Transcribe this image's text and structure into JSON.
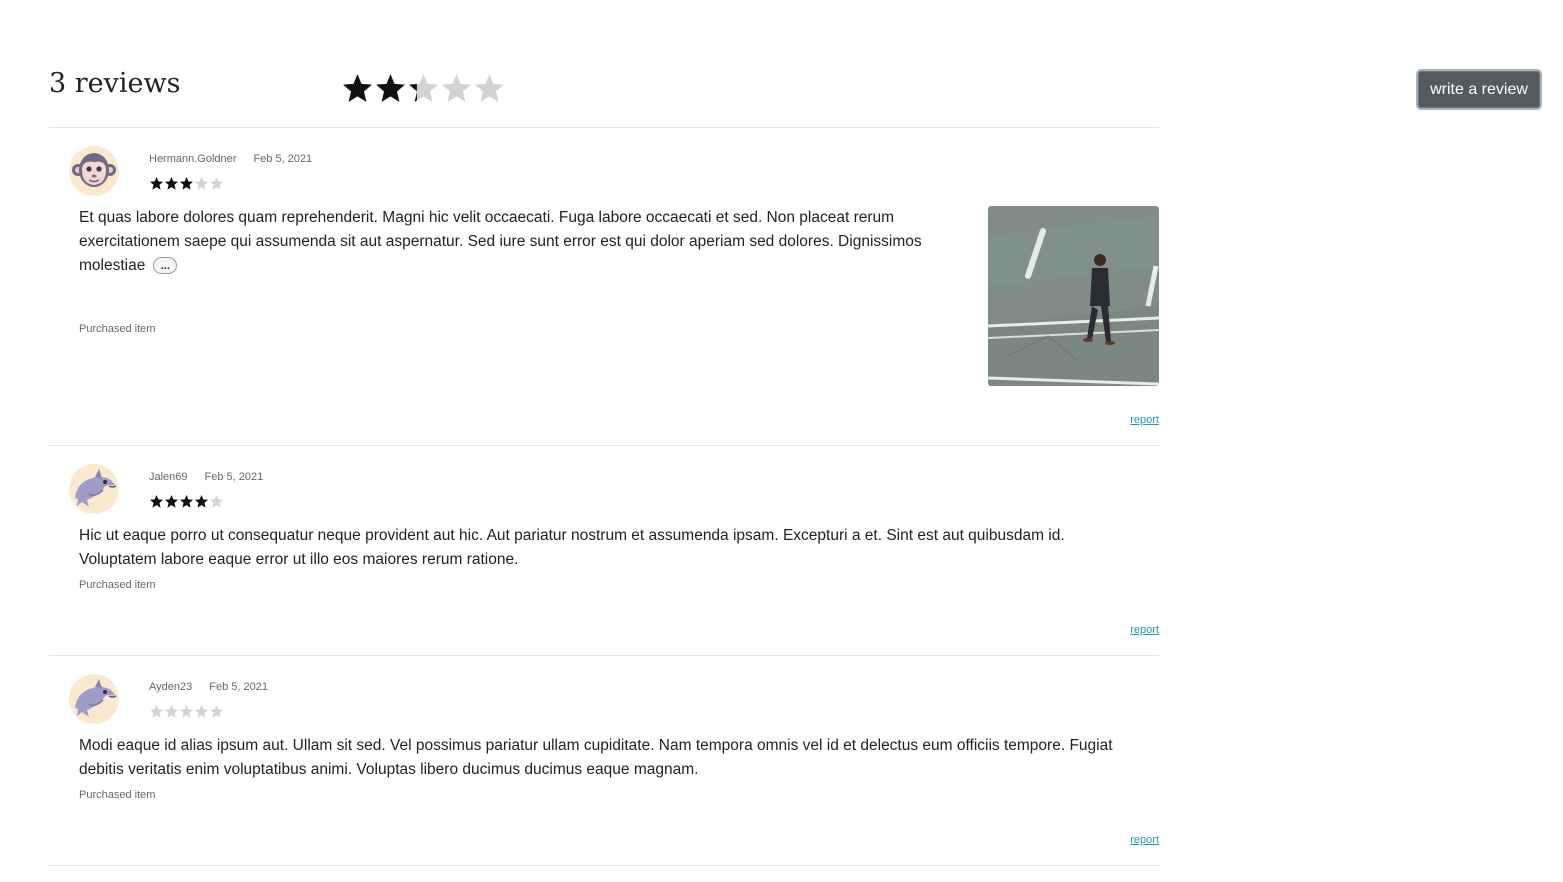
{
  "header": {
    "review_count": "3 reviews",
    "overall_rating": 2.3,
    "write_button": "write a review"
  },
  "reviews": [
    {
      "author": "Hermann.Goldner",
      "date": "Feb 5, 2021",
      "rating": 3,
      "avatar": "monkey-avatar",
      "body": "Et quas labore dolores quam reprehenderit. Magni hic velit occaecati. Fuga labore occaecati et sed. Non placeat rerum exercitationem saepe qui assumenda sit aut aspernatur. Sed iure sunt error est qui dolor aperiam sed dolores. Dignissimos molestiae",
      "more_label": "...",
      "purchased": "Purchased item",
      "report": "report",
      "photo": "street-photo"
    },
    {
      "author": "Jalen69",
      "date": "Feb 5, 2021",
      "rating": 4,
      "avatar": "dolphin-avatar",
      "body": "Hic ut eaque porro ut consequatur neque provident aut hic. Aut pariatur nostrum et assumenda ipsam. Excepturi a et. Sint est aut quibusdam id. Voluptatem labore eaque error ut illo eos maiores rerum ratione.",
      "purchased": "Purchased item",
      "report": "report"
    },
    {
      "author": "Ayden23",
      "date": "Feb 5, 2021",
      "rating": 0,
      "avatar": "dolphin-avatar",
      "body": "Modi eaque id alias ipsum aut. Ullam sit sed. Vel possimus pariatur ullam cupiditate. Nam tempora omnis vel id et delectus eum officiis tempore. Fugiat debitis veritatis enim voluptatibus animi. Voluptas libero ducimus ducimus eaque magnam.",
      "purchased": "Purchased item",
      "report": "report"
    }
  ],
  "colors": {
    "star_filled": "#111111",
    "star_empty": "#d3d3d3",
    "button_bg": "#555a5f",
    "link": "#1f9ab0",
    "avatar_bg": "#fbe9cf"
  }
}
